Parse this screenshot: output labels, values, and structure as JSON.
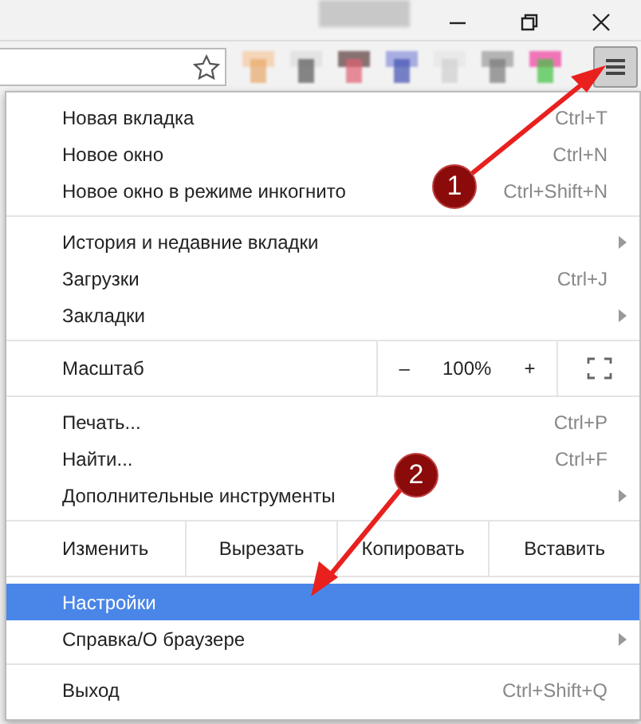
{
  "toolbar": {
    "menu_button": {
      "pressed": true
    }
  },
  "menu": {
    "sections": [
      {
        "kind": "items",
        "items": [
          {
            "kind": "command",
            "label": "Новая вкладка",
            "shortcut": "Ctrl+T",
            "selected": false
          },
          {
            "kind": "command",
            "label": "Новое окно",
            "shortcut": "Ctrl+N",
            "selected": false
          },
          {
            "kind": "command",
            "label": "Новое окно в режиме инкогнито",
            "shortcut": "Ctrl+Shift+N",
            "selected": false
          }
        ]
      },
      {
        "kind": "items",
        "items": [
          {
            "kind": "submenu",
            "label": "История и недавние вкладки",
            "selected": false
          },
          {
            "kind": "command",
            "label": "Загрузки",
            "shortcut": "Ctrl+J",
            "selected": false
          },
          {
            "kind": "submenu",
            "label": "Закладки",
            "selected": false
          }
        ]
      },
      {
        "kind": "zoom",
        "label": "Масштаб",
        "minus": "–",
        "value": "100%",
        "plus": "+"
      },
      {
        "kind": "items",
        "items": [
          {
            "kind": "command",
            "label": "Печать...",
            "shortcut": "Ctrl+P",
            "selected": false
          },
          {
            "kind": "command",
            "label": "Найти...",
            "shortcut": "Ctrl+F",
            "selected": false
          },
          {
            "kind": "submenu",
            "label": "Дополнительные инструменты",
            "selected": false
          }
        ]
      },
      {
        "kind": "edit",
        "label": "Изменить",
        "buttons": [
          "Вырезать",
          "Копировать",
          "Вставить"
        ]
      },
      {
        "kind": "items",
        "items": [
          {
            "kind": "command",
            "label": "Настройки",
            "selected": true
          },
          {
            "kind": "submenu",
            "label": "Справка/О браузере",
            "selected": false
          }
        ]
      },
      {
        "kind": "items",
        "items": [
          {
            "kind": "command",
            "label": "Выход",
            "shortcut": "Ctrl+Shift+Q",
            "selected": false
          }
        ]
      }
    ]
  },
  "annotations": [
    {
      "number": "1"
    },
    {
      "number": "2"
    }
  ]
}
